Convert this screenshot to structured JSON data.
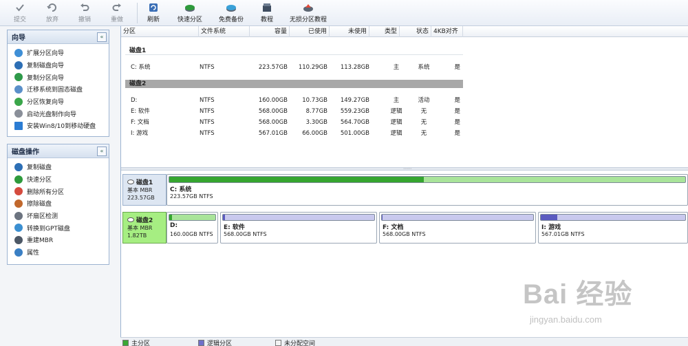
{
  "toolbar": {
    "buttons": [
      {
        "label": "提交",
        "icon": "check-icon",
        "enabled": false
      },
      {
        "label": "放弃",
        "icon": "discard-icon",
        "enabled": false
      },
      {
        "label": "撤销",
        "icon": "undo-icon",
        "enabled": false
      },
      {
        "label": "重做",
        "icon": "redo-icon",
        "enabled": false
      },
      {
        "label": "刷新",
        "icon": "refresh-icon",
        "enabled": true
      },
      {
        "label": "快速分区",
        "icon": "quick-partition-icon",
        "enabled": true
      },
      {
        "label": "免费备份",
        "icon": "backup-icon",
        "enabled": true
      },
      {
        "label": "教程",
        "icon": "tutorial-icon",
        "enabled": true
      },
      {
        "label": "无损分区教程",
        "icon": "lossless-tutorial-icon",
        "enabled": true
      }
    ]
  },
  "wizard_panel": {
    "title": "向导",
    "collapse_symbol": "«",
    "items": [
      {
        "label": "扩展分区向导",
        "icon": "extend-partition-icon"
      },
      {
        "label": "复制磁盘向导",
        "icon": "copy-disk-icon"
      },
      {
        "label": "复制分区向导",
        "icon": "copy-partition-icon"
      },
      {
        "label": "迁移系统到固态磁盘",
        "icon": "migrate-ssd-icon"
      },
      {
        "label": "分区恢复向导",
        "icon": "partition-recovery-icon"
      },
      {
        "label": "启动光盘制作向导",
        "icon": "boot-disc-icon"
      },
      {
        "label": "安装Win8/10到移动硬盘",
        "icon": "install-windows-icon"
      }
    ]
  },
  "disk_ops_panel": {
    "title": "磁盘操作",
    "collapse_symbol": "«",
    "items": [
      {
        "label": "复制磁盘",
        "icon": "copy-disk-icon"
      },
      {
        "label": "快速分区",
        "icon": "quick-partition-icon"
      },
      {
        "label": "删除所有分区",
        "icon": "delete-partitions-icon"
      },
      {
        "label": "擦除磁盘",
        "icon": "wipe-disk-icon"
      },
      {
        "label": "坏扇区检测",
        "icon": "bad-sector-icon"
      },
      {
        "label": "转换到GPT磁盘",
        "icon": "convert-gpt-icon"
      },
      {
        "label": "重建MBR",
        "icon": "rebuild-mbr-icon"
      },
      {
        "label": "属性",
        "icon": "properties-icon"
      }
    ]
  },
  "table": {
    "columns": [
      "分区",
      "文件系统",
      "容量",
      "已使用",
      "未使用",
      "类型",
      "状态",
      "4KB对齐"
    ],
    "groups": [
      {
        "name": "磁盘1",
        "rows": [
          {
            "partition": "C: 系统",
            "fs": "NTFS",
            "capacity": "223.57GB",
            "used": "110.29GB",
            "free": "113.28GB",
            "type": "主",
            "status": "系统",
            "aligned": "是"
          }
        ]
      },
      {
        "name": "磁盘2",
        "rows": [
          {
            "partition": "D:",
            "fs": "NTFS",
            "capacity": "160.00GB",
            "used": "10.73GB",
            "free": "149.27GB",
            "type": "主",
            "status": "活动",
            "aligned": "是"
          },
          {
            "partition": "E: 软件",
            "fs": "NTFS",
            "capacity": "568.00GB",
            "used": "8.77GB",
            "free": "559.23GB",
            "type": "逻辑",
            "status": "无",
            "aligned": "是"
          },
          {
            "partition": "F: 文档",
            "fs": "NTFS",
            "capacity": "568.00GB",
            "used": "3.30GB",
            "free": "564.70GB",
            "type": "逻辑",
            "status": "无",
            "aligned": "是"
          },
          {
            "partition": "I: 游戏",
            "fs": "NTFS",
            "capacity": "567.01GB",
            "used": "66.00GB",
            "free": "501.00GB",
            "type": "逻辑",
            "status": "无",
            "aligned": "是"
          }
        ]
      }
    ]
  },
  "disk_map": {
    "disks": [
      {
        "name": "磁盘1",
        "kind": "基本 MBR",
        "size": "223.57GB",
        "selected": false,
        "partitions": [
          {
            "name": "C: 系统",
            "detail": "223.57GB NTFS",
            "kind": "primary",
            "used_fraction": 0.493
          }
        ]
      },
      {
        "name": "磁盘2",
        "kind": "基本 MBR",
        "size": "1.82TB",
        "selected": true,
        "partitions": [
          {
            "name": "D:",
            "detail": "160.00GB NTFS",
            "kind": "primary",
            "used_fraction": 0.067
          },
          {
            "name": "E: 软件",
            "detail": "568.00GB NTFS",
            "kind": "logical",
            "used_fraction": 0.015
          },
          {
            "name": "F: 文档",
            "detail": "568.00GB NTFS",
            "kind": "logical",
            "used_fraction": 0.006
          },
          {
            "name": "I: 游戏",
            "detail": "567.01GB NTFS",
            "kind": "logical",
            "used_fraction": 0.116
          }
        ]
      }
    ]
  },
  "legend": [
    {
      "label": "主分区",
      "color": "#3aa835"
    },
    {
      "label": "逻辑分区",
      "color": "#6f6fc9"
    },
    {
      "label": "未分配空间",
      "color": "#f2f2f2"
    }
  ],
  "colors": {
    "primary_fill": "#35a52f",
    "primary_empty": "#a9e49a",
    "logical_fill": "#5b5bc0",
    "logical_empty": "#c9c9ee"
  },
  "watermark": {
    "main": "Bai 经验",
    "sub": "jingyan.baidu.com"
  }
}
